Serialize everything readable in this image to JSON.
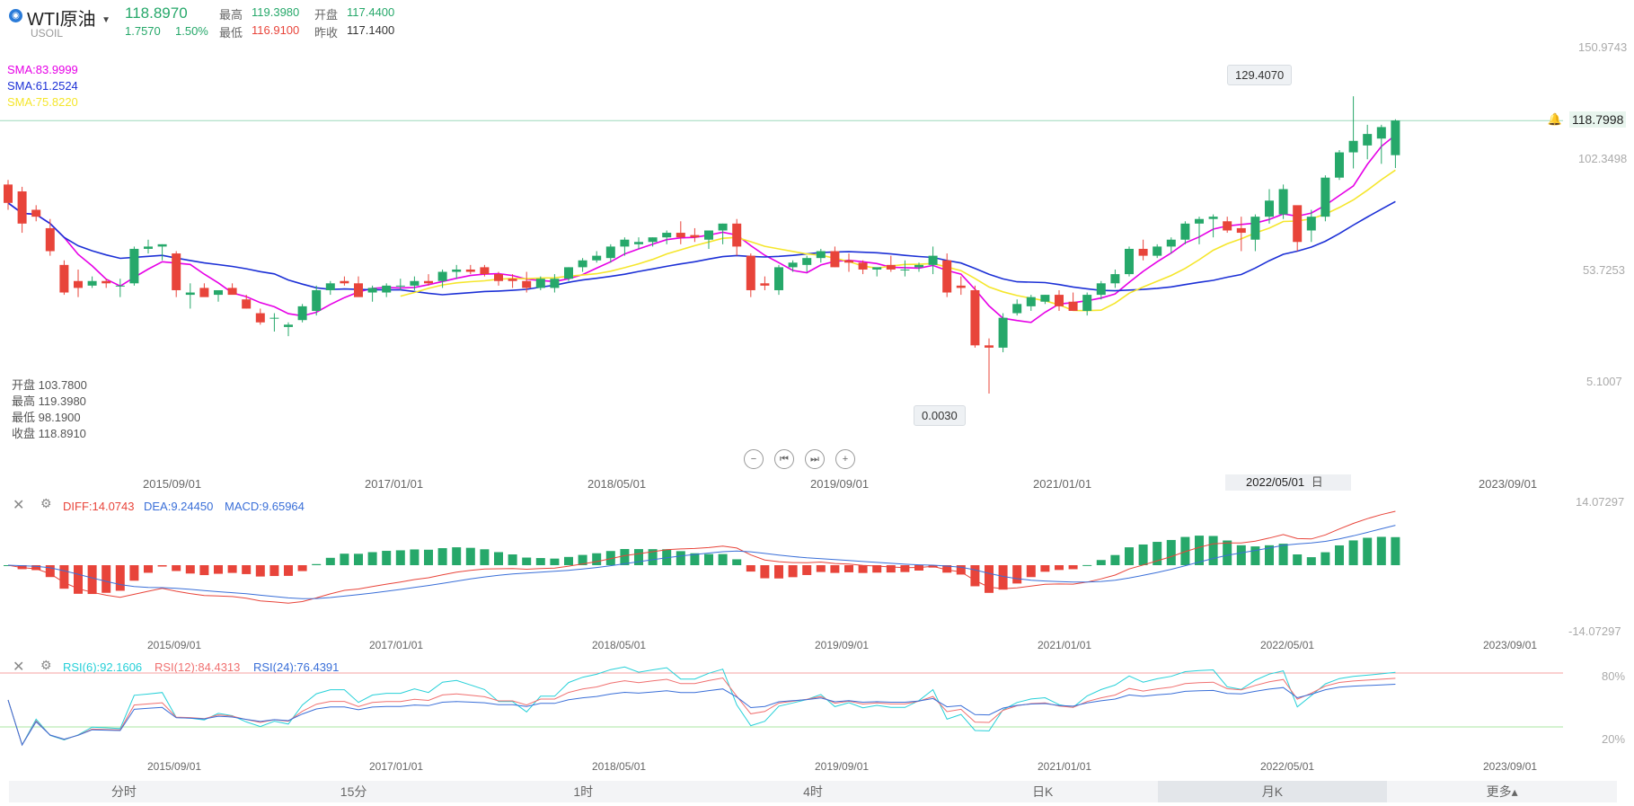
{
  "header": {
    "symbol": "WTI原油",
    "code": "USOIL",
    "price": "118.8970",
    "change": "1.7570",
    "change_pct": "1.50%",
    "high_label": "最高",
    "high": "119.3980",
    "low_label": "最低",
    "low": "116.9100",
    "open_label": "开盘",
    "open": "117.4400",
    "prev_label": "昨收",
    "prev": "117.1400"
  },
  "sma": [
    {
      "label": "SMA:83.9999",
      "color": "#e600e6"
    },
    {
      "label": "SMA:61.2524",
      "color": "#1c30d6"
    },
    {
      "label": "SMA:75.8220",
      "color": "#f5e62c"
    }
  ],
  "ohlc_box": [
    {
      "label": "开盘",
      "value": "103.7800"
    },
    {
      "label": "最高",
      "value": "119.3980"
    },
    {
      "label": "最低",
      "value": "98.1900"
    },
    {
      "label": "收盘",
      "value": "118.8910"
    }
  ],
  "price_axis": [
    "150.9743",
    "102.3498",
    "53.7253",
    "5.1007"
  ],
  "last_price": "118.7998",
  "max_marker": "129.4070",
  "min_marker": "0.0030",
  "x_dates": [
    "2015/09/01",
    "2017/01/01",
    "2018/05/01",
    "2019/09/01",
    "2021/01/01",
    "2023/09/01"
  ],
  "crosshair_date": "2022/05/01",
  "crosshair_suffix": "日",
  "sub_x_dates": [
    "2015/09/01",
    "2017/01/01",
    "2018/05/01",
    "2019/09/01",
    "2021/01/01",
    "2022/05/01",
    "2023/09/01"
  ],
  "macd": {
    "diff": "DIFF:14.0743",
    "dea": "DEA:9.24450",
    "macd": "MACD:9.65964",
    "axis_top": "14.07297",
    "axis_bottom": "-14.07297",
    "colors": {
      "diff": "#e8443a",
      "dea": "#3a6fd8"
    }
  },
  "rsi": {
    "rsi6": "RSI(6):92.1606",
    "rsi12": "RSI(12):84.4313",
    "rsi24": "RSI(24):76.4391",
    "axis_top": "80%",
    "axis_bottom": "20%",
    "colors": {
      "rsi6": "#26d0d8",
      "rsi12": "#f07070",
      "rsi24": "#3a6fd8"
    }
  },
  "tabs": [
    {
      "label": "分时",
      "active": false
    },
    {
      "label": "15分",
      "active": false
    },
    {
      "label": "1时",
      "active": false
    },
    {
      "label": "4时",
      "active": false
    },
    {
      "label": "日K",
      "active": false
    },
    {
      "label": "月K",
      "active": true
    },
    {
      "label": "更多▴",
      "active": false
    }
  ],
  "colors": {
    "up": "#26a86a",
    "down": "#e8443a"
  },
  "chart_data": [
    {
      "type": "candlestick",
      "title": "WTI原油 月K",
      "ylim": [
        5.1007,
        150.9743
      ],
      "candles": [
        {
          "t": "2014-10",
          "o": 91,
          "h": 93,
          "l": 80,
          "c": 83
        },
        {
          "t": "2014-11",
          "o": 88,
          "h": 90,
          "l": 70,
          "c": 74
        },
        {
          "t": "2014-12",
          "o": 80,
          "h": 82,
          "l": 75,
          "c": 77
        },
        {
          "t": "2015-01",
          "o": 72,
          "h": 76,
          "l": 60,
          "c": 62
        },
        {
          "t": "2015-02",
          "o": 56,
          "h": 58,
          "l": 43,
          "c": 44
        },
        {
          "t": "2015-03",
          "o": 49,
          "h": 54,
          "l": 42,
          "c": 46
        },
        {
          "t": "2015-04",
          "o": 47,
          "h": 51,
          "l": 46,
          "c": 49
        },
        {
          "t": "2015-05",
          "o": 49,
          "h": 50,
          "l": 46,
          "c": 48
        },
        {
          "t": "2015-06",
          "o": 47,
          "h": 50,
          "l": 42,
          "c": 47
        },
        {
          "t": "2015-07",
          "o": 48,
          "h": 64,
          "l": 47,
          "c": 63
        },
        {
          "t": "2015-08",
          "o": 63,
          "h": 67,
          "l": 61,
          "c": 64
        },
        {
          "t": "2015-09",
          "o": 64,
          "h": 65,
          "l": 58,
          "c": 65
        },
        {
          "t": "2015-10",
          "o": 61,
          "h": 62,
          "l": 42,
          "c": 45
        },
        {
          "t": "2015-11",
          "o": 43,
          "h": 48,
          "l": 37,
          "c": 44
        },
        {
          "t": "2015-12",
          "o": 46,
          "h": 48,
          "l": 43,
          "c": 42
        },
        {
          "t": "2016-01",
          "o": 43,
          "h": 44,
          "l": 40,
          "c": 45
        },
        {
          "t": "2016-02",
          "o": 46,
          "h": 48,
          "l": 44,
          "c": 43
        },
        {
          "t": "2016-03",
          "o": 41,
          "h": 43,
          "l": 37,
          "c": 37
        },
        {
          "t": "2016-04",
          "o": 35,
          "h": 37,
          "l": 30,
          "c": 31
        },
        {
          "t": "2016-05",
          "o": 33,
          "h": 35,
          "l": 27,
          "c": 33
        },
        {
          "t": "2016-06",
          "o": 29,
          "h": 31,
          "l": 25,
          "c": 30
        },
        {
          "t": "2016-07",
          "o": 32,
          "h": 39,
          "l": 31,
          "c": 38
        },
        {
          "t": "2016-08",
          "o": 36,
          "h": 47,
          "l": 34,
          "c": 45
        },
        {
          "t": "2016-09",
          "o": 45,
          "h": 49,
          "l": 43,
          "c": 48
        },
        {
          "t": "2016-10",
          "o": 49,
          "h": 51,
          "l": 47,
          "c": 48
        },
        {
          "t": "2016-11",
          "o": 48,
          "h": 51,
          "l": 43,
          "c": 42
        },
        {
          "t": "2016-12",
          "o": 44,
          "h": 47,
          "l": 40,
          "c": 46
        },
        {
          "t": "2017-01",
          "o": 44,
          "h": 48,
          "l": 42,
          "c": 47
        },
        {
          "t": "2017-02",
          "o": 47,
          "h": 50,
          "l": 45,
          "c": 47
        },
        {
          "t": "2017-03",
          "o": 47,
          "h": 51,
          "l": 45,
          "c": 49
        },
        {
          "t": "2017-04",
          "o": 49,
          "h": 52,
          "l": 47,
          "c": 48
        },
        {
          "t": "2017-05",
          "o": 49,
          "h": 54,
          "l": 46,
          "c": 53
        },
        {
          "t": "2017-06",
          "o": 53,
          "h": 56,
          "l": 50,
          "c": 54
        },
        {
          "t": "2017-07",
          "o": 54,
          "h": 56,
          "l": 52,
          "c": 53
        },
        {
          "t": "2017-08",
          "o": 55,
          "h": 56,
          "l": 51,
          "c": 52
        },
        {
          "t": "2017-09",
          "o": 52,
          "h": 53,
          "l": 47,
          "c": 49
        },
        {
          "t": "2017-10",
          "o": 50,
          "h": 52,
          "l": 46,
          "c": 49
        },
        {
          "t": "2017-11",
          "o": 49,
          "h": 53,
          "l": 44,
          "c": 46
        },
        {
          "t": "2017-12",
          "o": 46,
          "h": 51,
          "l": 45,
          "c": 50
        },
        {
          "t": "2018-01",
          "o": 46,
          "h": 52,
          "l": 44,
          "c": 50
        },
        {
          "t": "2018-02",
          "o": 50,
          "h": 55,
          "l": 49,
          "c": 55
        },
        {
          "t": "2018-03",
          "o": 55,
          "h": 59,
          "l": 53,
          "c": 58
        },
        {
          "t": "2018-04",
          "o": 58,
          "h": 62,
          "l": 57,
          "c": 60
        },
        {
          "t": "2018-05",
          "o": 59,
          "h": 65,
          "l": 57,
          "c": 64
        },
        {
          "t": "2018-06",
          "o": 64,
          "h": 68,
          "l": 60,
          "c": 67
        },
        {
          "t": "2018-07",
          "o": 65,
          "h": 68,
          "l": 63,
          "c": 66
        },
        {
          "t": "2018-08",
          "o": 66,
          "h": 68,
          "l": 64,
          "c": 68
        },
        {
          "t": "2018-09",
          "o": 68,
          "h": 71,
          "l": 65,
          "c": 70
        },
        {
          "t": "2018-10",
          "o": 70,
          "h": 75,
          "l": 65,
          "c": 68
        },
        {
          "t": "2018-11",
          "o": 69,
          "h": 72,
          "l": 66,
          "c": 68
        },
        {
          "t": "2018-12",
          "o": 67,
          "h": 70,
          "l": 63,
          "c": 71
        },
        {
          "t": "2019-01",
          "o": 71,
          "h": 74,
          "l": 65,
          "c": 74
        },
        {
          "t": "2019-02",
          "o": 74,
          "h": 76,
          "l": 60,
          "c": 64
        },
        {
          "t": "2019-03",
          "o": 60,
          "h": 61,
          "l": 42,
          "c": 45
        },
        {
          "t": "2019-04",
          "o": 48,
          "h": 51,
          "l": 45,
          "c": 47
        },
        {
          "t": "2019-05",
          "o": 45,
          "h": 56,
          "l": 43,
          "c": 55
        },
        {
          "t": "2019-06",
          "o": 55,
          "h": 58,
          "l": 53,
          "c": 57
        },
        {
          "t": "2019-07",
          "o": 56,
          "h": 60,
          "l": 53,
          "c": 59
        },
        {
          "t": "2019-08",
          "o": 59,
          "h": 63,
          "l": 57,
          "c": 62
        },
        {
          "t": "2019-09",
          "o": 62,
          "h": 64,
          "l": 55,
          "c": 55
        },
        {
          "t": "2019-10",
          "o": 58,
          "h": 61,
          "l": 53,
          "c": 57
        },
        {
          "t": "2019-11",
          "o": 57,
          "h": 58,
          "l": 52,
          "c": 54
        },
        {
          "t": "2019-12",
          "o": 54,
          "h": 55,
          "l": 51,
          "c": 55
        },
        {
          "t": "2020-01",
          "o": 56,
          "h": 60,
          "l": 53,
          "c": 54
        },
        {
          "t": "2020-02",
          "o": 54,
          "h": 58,
          "l": 51,
          "c": 54
        },
        {
          "t": "2020-03",
          "o": 55,
          "h": 57,
          "l": 53,
          "c": 56
        },
        {
          "t": "2020-04",
          "o": 56,
          "h": 64,
          "l": 52,
          "c": 60
        },
        {
          "t": "2020-05",
          "o": 58,
          "h": 61,
          "l": 42,
          "c": 44
        },
        {
          "t": "2020-06",
          "o": 47,
          "h": 51,
          "l": 43,
          "c": 46
        },
        {
          "t": "2020-07",
          "o": 45,
          "h": 47,
          "l": 20,
          "c": 21
        },
        {
          "t": "2020-08",
          "o": 21,
          "h": 24,
          "l": 0.003,
          "c": 20
        },
        {
          "t": "2020-09",
          "o": 20,
          "h": 35,
          "l": 18,
          "c": 33
        },
        {
          "t": "2020-10",
          "o": 35,
          "h": 41,
          "l": 34,
          "c": 39
        },
        {
          "t": "2020-11",
          "o": 38,
          "h": 43,
          "l": 36,
          "c": 42
        },
        {
          "t": "2020-12",
          "o": 40,
          "h": 43,
          "l": 39,
          "c": 43
        },
        {
          "t": "2021-01",
          "o": 43,
          "h": 45,
          "l": 36,
          "c": 38
        },
        {
          "t": "2021-02",
          "o": 40,
          "h": 44,
          "l": 36,
          "c": 36
        },
        {
          "t": "2021-03",
          "o": 36,
          "h": 44,
          "l": 34,
          "c": 43
        },
        {
          "t": "2021-04",
          "o": 43,
          "h": 49,
          "l": 41,
          "c": 48
        },
        {
          "t": "2021-05",
          "o": 48,
          "h": 54,
          "l": 46,
          "c": 52
        },
        {
          "t": "2021-06",
          "o": 52,
          "h": 64,
          "l": 51,
          "c": 63
        },
        {
          "t": "2021-07",
          "o": 63,
          "h": 67,
          "l": 58,
          "c": 60
        },
        {
          "t": "2021-08",
          "o": 60,
          "h": 65,
          "l": 59,
          "c": 64
        },
        {
          "t": "2021-09",
          "o": 64,
          "h": 68,
          "l": 61,
          "c": 67
        },
        {
          "t": "2021-10",
          "o": 67,
          "h": 75,
          "l": 65,
          "c": 74
        },
        {
          "t": "2021-11",
          "o": 74,
          "h": 77,
          "l": 65,
          "c": 76
        },
        {
          "t": "2021-12",
          "o": 76,
          "h": 78,
          "l": 68,
          "c": 77
        },
        {
          "t": "2022-01",
          "o": 75,
          "h": 77,
          "l": 70,
          "c": 71
        },
        {
          "t": "2022-02",
          "o": 72,
          "h": 77,
          "l": 62,
          "c": 70
        },
        {
          "t": "2022-03",
          "o": 67,
          "h": 78,
          "l": 62,
          "c": 77
        },
        {
          "t": "2022-04",
          "o": 77,
          "h": 89,
          "l": 74,
          "c": 84
        },
        {
          "t": "2022-05",
          "o": 78,
          "h": 91,
          "l": 76,
          "c": 89
        },
        {
          "t": "2022-06",
          "o": 82,
          "h": 78,
          "l": 62,
          "c": 66
        },
        {
          "t": "2022-07",
          "o": 71,
          "h": 80,
          "l": 66,
          "c": 77
        },
        {
          "t": "2022-08",
          "o": 77,
          "h": 95,
          "l": 75,
          "c": 94
        },
        {
          "t": "2022-09",
          "o": 94,
          "h": 106,
          "l": 93,
          "c": 105
        },
        {
          "t": "2022-10",
          "o": 105,
          "h": 129.407,
          "l": 98,
          "c": 110
        },
        {
          "t": "2022-11",
          "o": 108,
          "h": 117,
          "l": 102,
          "c": 113
        },
        {
          "t": "2022-12",
          "o": 111,
          "h": 117,
          "l": 100,
          "c": 116
        },
        {
          "t": "2023-01",
          "o": 103.78,
          "h": 119.398,
          "l": 98.19,
          "c": 118.891
        }
      ]
    }
  ]
}
